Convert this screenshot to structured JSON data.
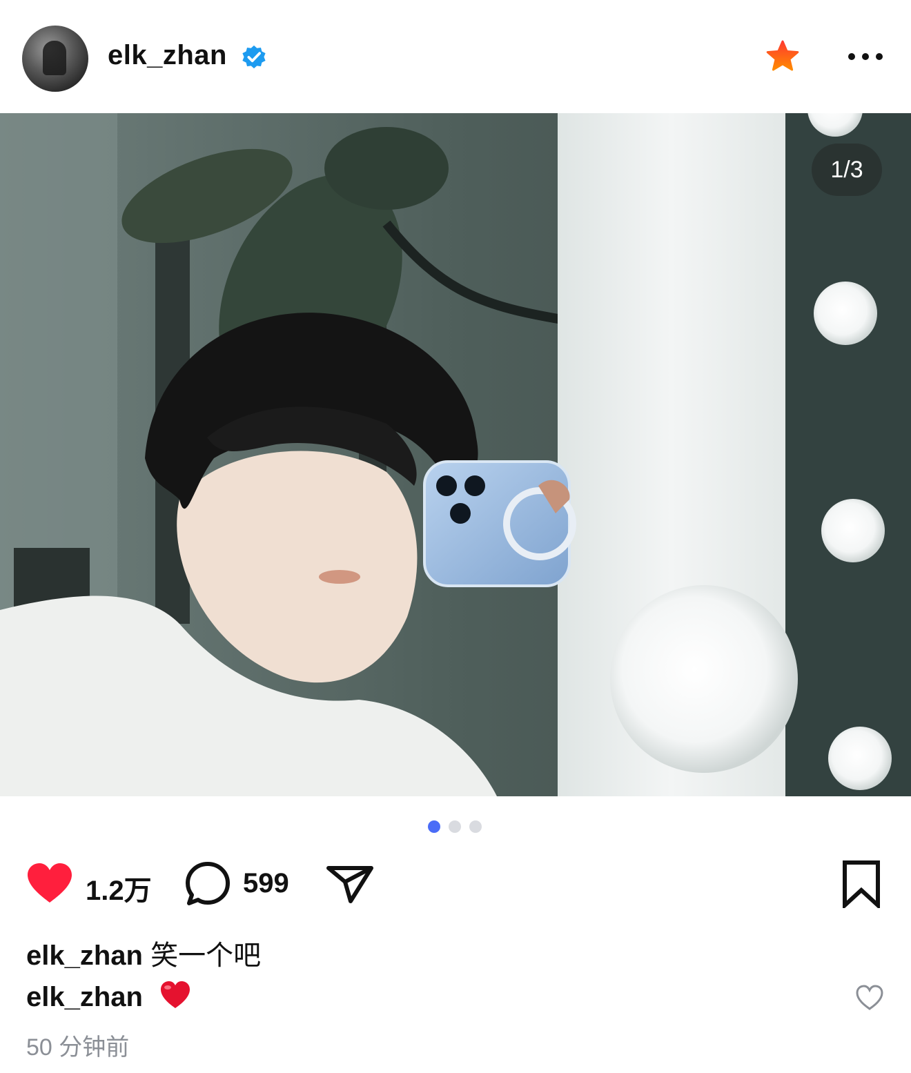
{
  "header": {
    "username": "elk_zhan",
    "verified_icon": "verified-badge-icon",
    "favorite_icon": "star-icon",
    "more_icon": "more-icon",
    "accent_blue": "#1d9bf0",
    "star_color": "#ff5a1f"
  },
  "post": {
    "image_counter": "1/3",
    "pagination": {
      "total": 3,
      "active": 1,
      "active_color": "#4a6cf7"
    },
    "likes": "1.2万",
    "comments": "599",
    "like_color": "#ff1f3d"
  },
  "caption": {
    "username": "elk_zhan",
    "text": "笑一个吧"
  },
  "top_comment": {
    "username": "elk_zhan",
    "emoji": "❤️"
  },
  "timestamp": "50 分钟前"
}
